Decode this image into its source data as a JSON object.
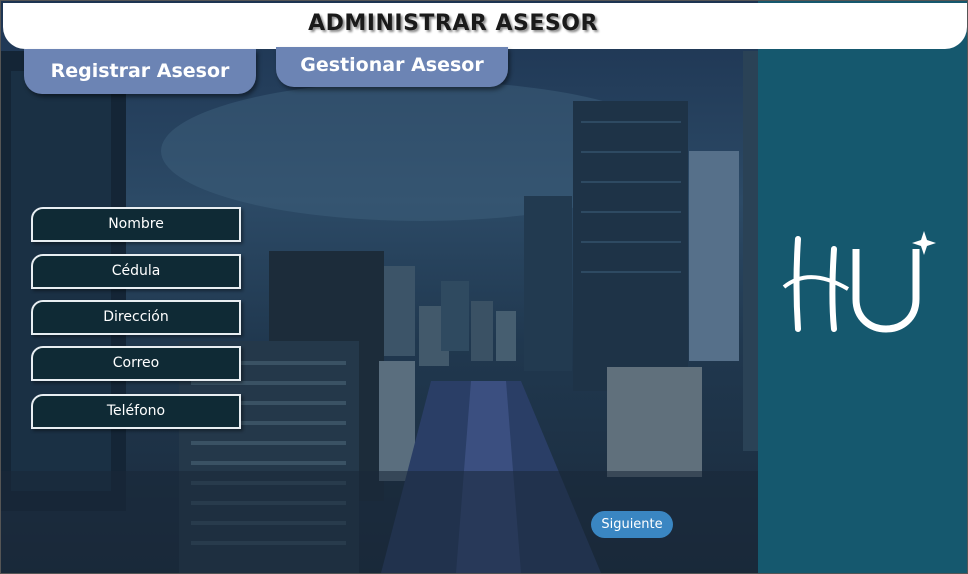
{
  "header": {
    "title": "ADMINISTRAR ASESOR"
  },
  "tabs": {
    "register_label": "Registrar Asesor",
    "manage_label": "Gestionar Asesor"
  },
  "form": {
    "fields": [
      {
        "label": "Nombre"
      },
      {
        "label": "Cédula"
      },
      {
        "label": "Dirección"
      },
      {
        "label": "Correo"
      },
      {
        "label": "Teléfono"
      }
    ]
  },
  "actions": {
    "next_label": "Siguiente"
  },
  "colors": {
    "side_panel": "#15586e",
    "tab": "#6c84b4",
    "field_bg": "#0f2a35",
    "next_button": "#3a86c2"
  },
  "logo": {
    "icon": "hu-logo"
  }
}
